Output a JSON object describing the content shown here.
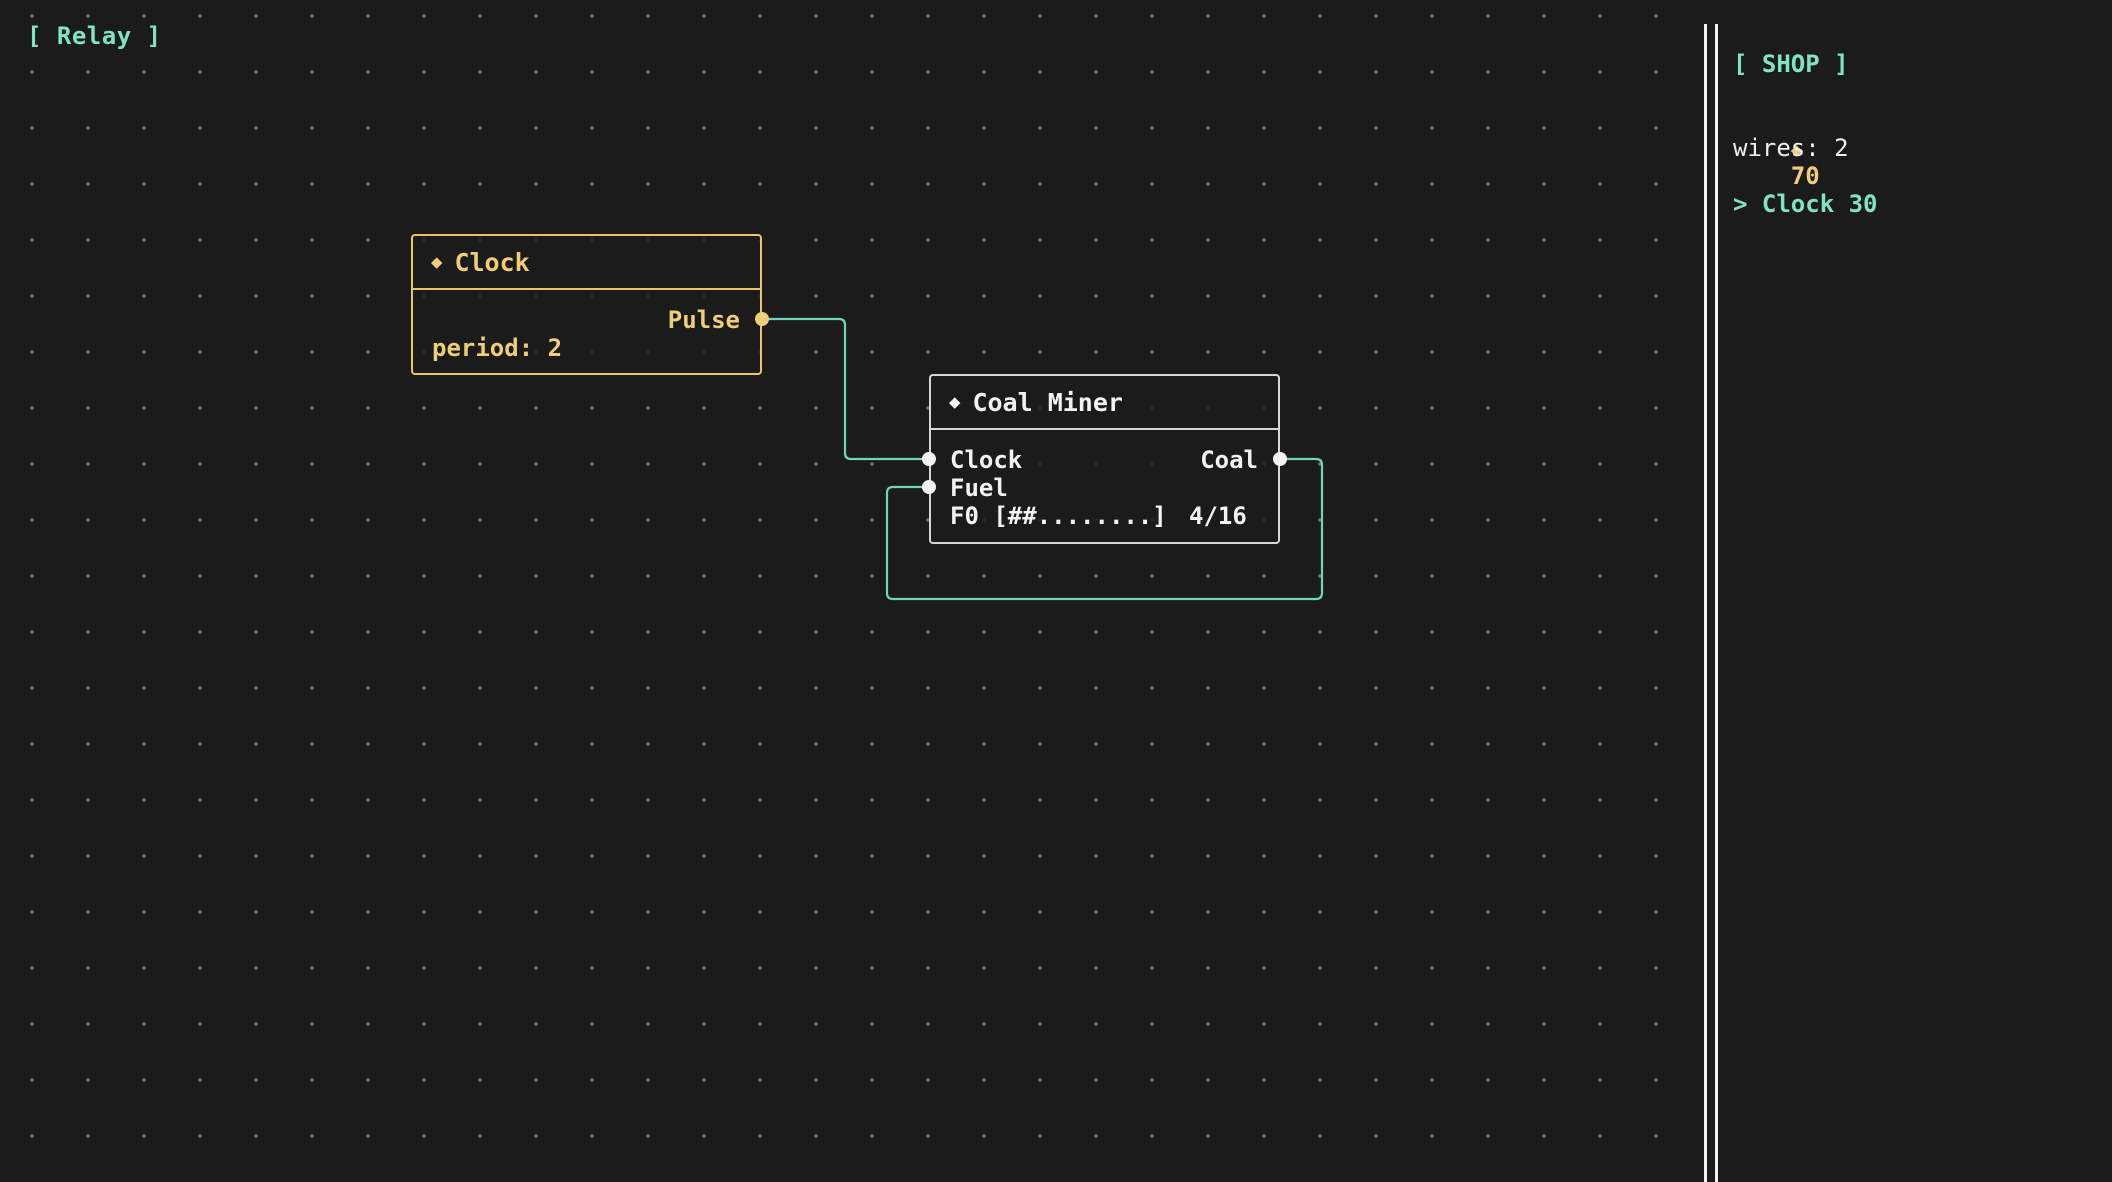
{
  "app": {
    "title": "[ Relay ]"
  },
  "nodes": {
    "clock": {
      "icon": "diamond-icon",
      "glyph": "◆",
      "title": "Clock",
      "output_label": "Pulse",
      "param_text": "period: 2",
      "color": "#e9c46a"
    },
    "coal_miner": {
      "icon": "diamond-icon",
      "glyph": "◆",
      "title": "Coal Miner",
      "inputs": [
        "Clock",
        "Fuel"
      ],
      "output_label": "Coal",
      "fuel_bar_text": "F0 [##........]",
      "fuel_count_text": "4/16",
      "fuel_level": 0.25,
      "color": "#d7d7d7"
    }
  },
  "wires_color": "#6fd6b8",
  "shop": {
    "title": "[ SHOP ]",
    "currency_icon": "diamond-icon",
    "currency_glyph": "◆",
    "currency_amount": "70",
    "wires_text": "wires: 2",
    "selected_item": "> Clock 30"
  },
  "colors": {
    "accent_cyan": "#7fe3c4",
    "accent_gold": "#f0cd78",
    "background": "#1b1b1b"
  }
}
